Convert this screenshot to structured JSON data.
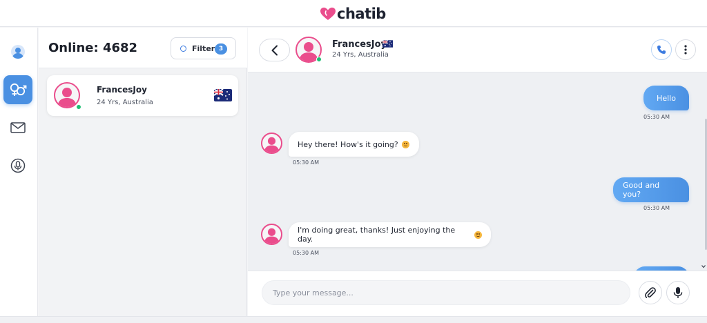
{
  "app": {
    "logo_text": "chatib",
    "brand_color": "#ea4d8c",
    "accent_color": "#4a90e2"
  },
  "rail": {
    "items": [
      {
        "icon": "profile-icon",
        "active": false
      },
      {
        "icon": "gender-icon",
        "active": true
      },
      {
        "icon": "mail-icon",
        "active": false
      },
      {
        "icon": "microphone-icon",
        "active": false
      }
    ]
  },
  "users_panel": {
    "online_label": "Online: 4682",
    "filter": {
      "label": "Filter",
      "badge": "3"
    },
    "users": [
      {
        "name": "FrancesJoy",
        "details": "24 Yrs, Australia",
        "online": true,
        "flag": "australia-flag"
      }
    ]
  },
  "chat": {
    "header": {
      "name": "FrancesJoy",
      "details": "24 Yrs, Australia",
      "flag": "australia-flag",
      "online": true
    },
    "messages": [
      {
        "direction": "out",
        "text": "Hello",
        "time": "05:30 AM"
      },
      {
        "direction": "in",
        "text": "Hey there! How's it going?",
        "emoji": "smile",
        "time": "05:30 AM"
      },
      {
        "direction": "out",
        "text": "Good and you?",
        "time": "05:30 AM"
      },
      {
        "direction": "in",
        "text": "I'm doing great, thanks! Just enjoying the day.",
        "emoji": "smile",
        "time": "05:30 AM"
      }
    ],
    "composer": {
      "placeholder": "Type your message..."
    }
  }
}
